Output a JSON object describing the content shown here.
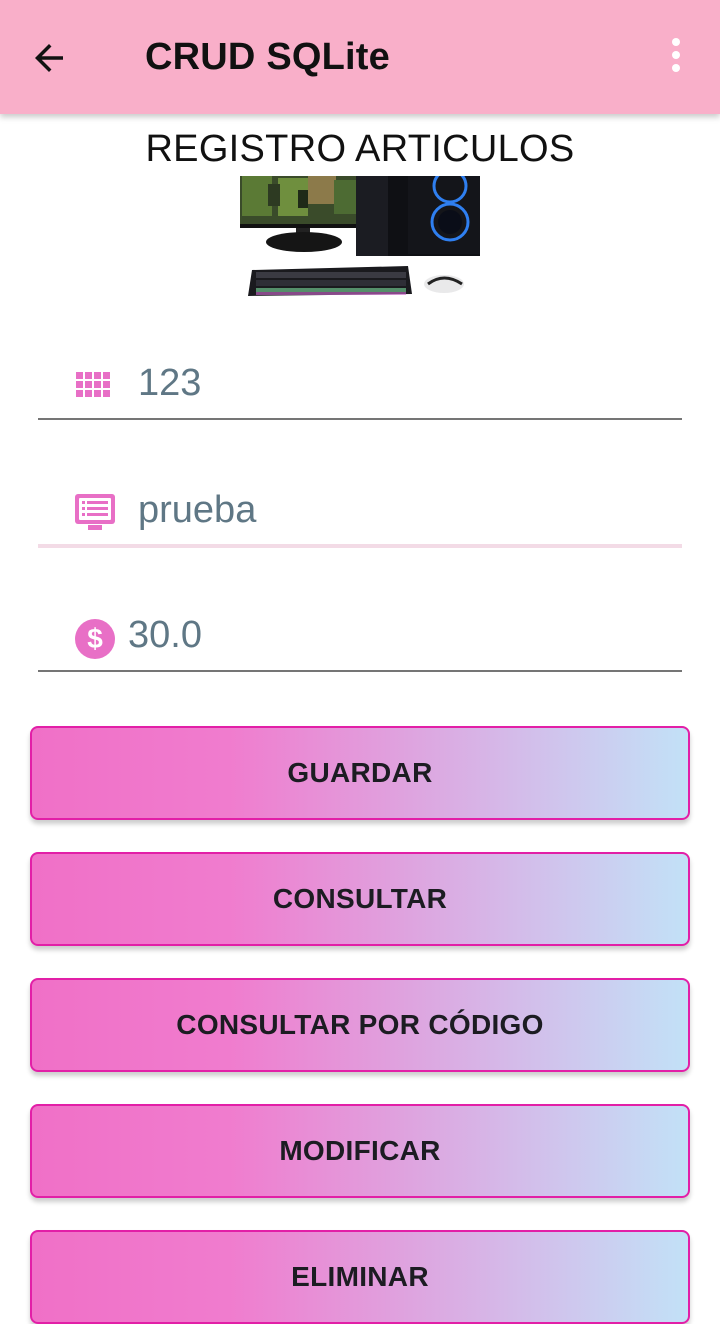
{
  "app_bar": {
    "title": "CRUD SQLite",
    "background": "#f9afc9",
    "back_icon": "arrow-back-icon",
    "menu_icon": "more-vert-icon"
  },
  "form": {
    "heading": "REGISTRO ARTICULOS",
    "image": "computer-setup-image",
    "fields": [
      {
        "icon": "keypad-grid-icon",
        "value": "123"
      },
      {
        "icon": "description-card-icon",
        "value": "prueba"
      },
      {
        "icon": "dollar-circle-icon",
        "value": "30.0"
      }
    ],
    "icon_color": "#e86fc6"
  },
  "buttons": [
    {
      "label": "GUARDAR"
    },
    {
      "label": "CONSULTAR"
    },
    {
      "label": "CONSULTAR POR CÓDIGO"
    },
    {
      "label": "MODIFICAR"
    },
    {
      "label": "ELIMINAR"
    }
  ],
  "colors": {
    "button_border": "#e21fa7",
    "button_gradient_start": "#f070c7",
    "button_gradient_end": "#c2e1f7",
    "field_text": "#5f7785"
  }
}
